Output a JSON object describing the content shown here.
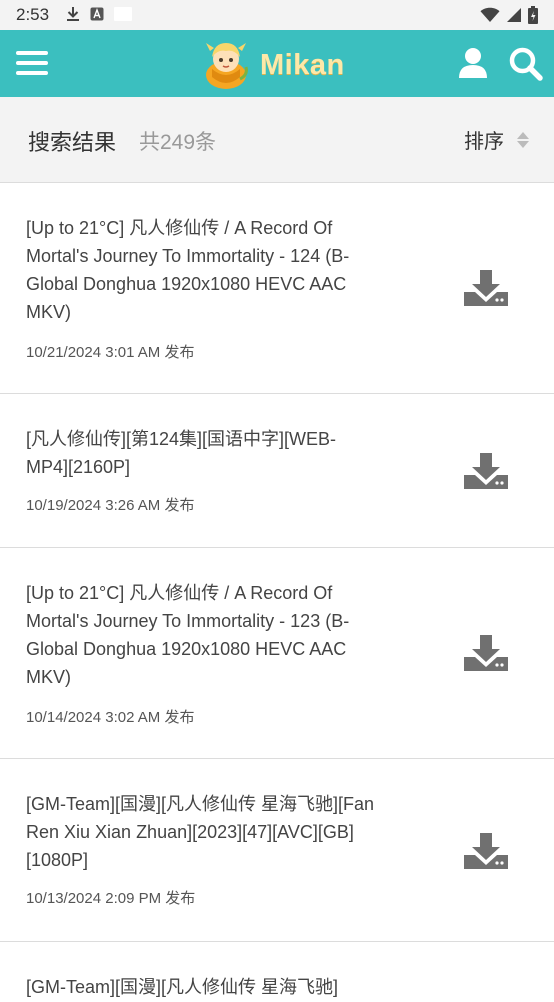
{
  "status_bar": {
    "time": "2:53"
  },
  "app_bar": {
    "brand": "Mikan",
    "colors": {
      "accent": "#3bbfbf"
    },
    "icons": [
      "menu-icon",
      "user-icon",
      "search-icon"
    ]
  },
  "results_header": {
    "title": "搜索结果",
    "count": "共249条",
    "sort_label": "排序"
  },
  "results": [
    {
      "title": "[Up to 21°C] 凡人修仙传 / A Record Of Mortal's Journey To Immortality - 124 (B-Global Donghua 1920x1080 HEVC AAC MKV)",
      "date": "10/21/2024 3:01 AM 发布"
    },
    {
      "title": "[凡人修仙传][第124集][国语中字][WEB-MP4][2160P]",
      "date": "10/19/2024 3:26 AM 发布"
    },
    {
      "title": "[Up to 21°C] 凡人修仙传 / A Record Of Mortal's Journey To Immortality - 123 (B-Global Donghua 1920x1080 HEVC AAC MKV)",
      "date": "10/14/2024 3:02 AM 发布"
    },
    {
      "title": "[GM-Team][国漫][凡人修仙传 星海飞驰][Fan Ren Xiu Xian Zhuan][2023][47][AVC][GB][1080P]",
      "date": "10/13/2024 2:09 PM 发布"
    },
    {
      "title": "[GM-Team][国漫][凡人修仙传 星海飞驰]",
      "date": ""
    }
  ]
}
